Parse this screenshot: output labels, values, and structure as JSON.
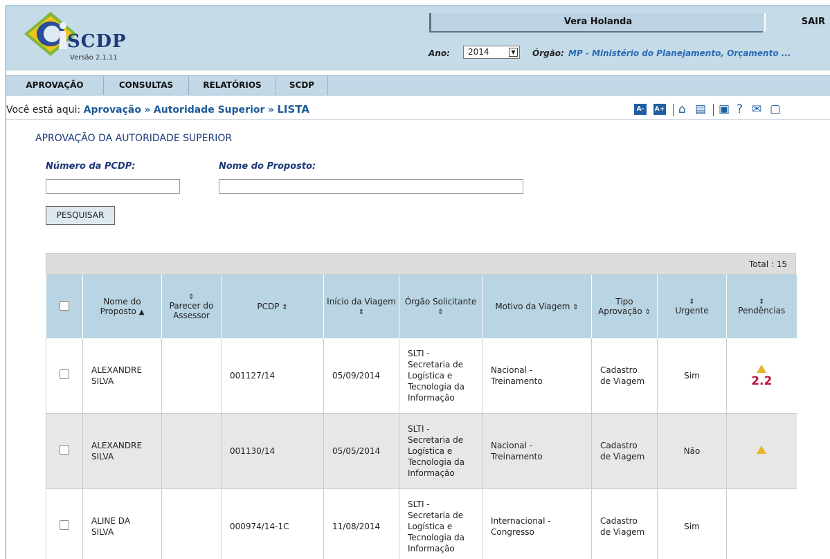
{
  "header": {
    "logo_text": "SCDP",
    "version": "Versão 2.1.11",
    "user_name": "Vera Holanda",
    "logout_label": "SAIR",
    "ano_label": "Ano:",
    "ano_value": "2014",
    "orgao_label": "Órgão:",
    "orgao_value": "MP - Ministério do Planejamento, Orçamento ..."
  },
  "menu": [
    {
      "label": "APROVAÇÃO"
    },
    {
      "label": "CONSULTAS"
    },
    {
      "label": "RELATÓRIOS"
    },
    {
      "label": "SCDP"
    }
  ],
  "breadcrumb": {
    "prefix": "Você está aqui:",
    "items": [
      "Aprovação",
      "Autoridade Superior",
      "LISTA"
    ],
    "separator": "»"
  },
  "toolbar": {
    "font_decrease": "A-",
    "font_increase": "A+",
    "icons": [
      "home-icon",
      "comment-icon",
      "video-icon",
      "help-icon",
      "mail-icon",
      "chat-icon"
    ]
  },
  "page": {
    "title": "APROVAÇÃO DA AUTORIDADE SUPERIOR",
    "pcdp_label": "Número da PCDP:",
    "pcdp_value": "",
    "proposto_label": "Nome do Proposto:",
    "proposto_value": "",
    "search_button": "PESQUISAR"
  },
  "grid": {
    "total": "Total : 15",
    "columns": [
      "Nome do Proposto",
      "Parecer do Assessor",
      "PCDP",
      "Início da Viagem",
      "Órgão Solicitante",
      "Motivo da Viagem",
      "Tipo Aprovação",
      "Urgente",
      "Pendências"
    ],
    "rows": [
      {
        "nome": "ALEXANDRE SILVA",
        "parecer": "",
        "pcdp": "001127/14",
        "inicio": "05/09/2014",
        "orgao": "SLTI - Secretaria de Logística e Tecnologia da Informação",
        "motivo": "Nacional - Treinamento",
        "tipo": "Cadastro de Viagem",
        "urgente": "Sim",
        "pendencia_code": "2.2"
      },
      {
        "nome": "ALEXANDRE SILVA",
        "parecer": "",
        "pcdp": "001130/14",
        "inicio": "05/05/2014",
        "orgao": "SLTI - Secretaria de Logística e Tecnologia da Informação",
        "motivo": "Nacional - Treinamento",
        "tipo": "Cadastro de Viagem",
        "urgente": "Não",
        "pendencia_code": ""
      },
      {
        "nome": "ALINE DA SILVA",
        "parecer": "",
        "pcdp": "000974/14-1C",
        "inicio": "11/08/2014",
        "orgao": "SLTI - Secretaria de Logística e Tecnologia da Informação",
        "motivo": "Internacional - Congresso",
        "tipo": "Cadastro de Viagem",
        "urgente": "Sim",
        "pendencia_code": ""
      }
    ]
  },
  "colors": {
    "header_bg": "#c5dbe8",
    "accent": "#1e5fa0",
    "alert": "#c0143c"
  }
}
